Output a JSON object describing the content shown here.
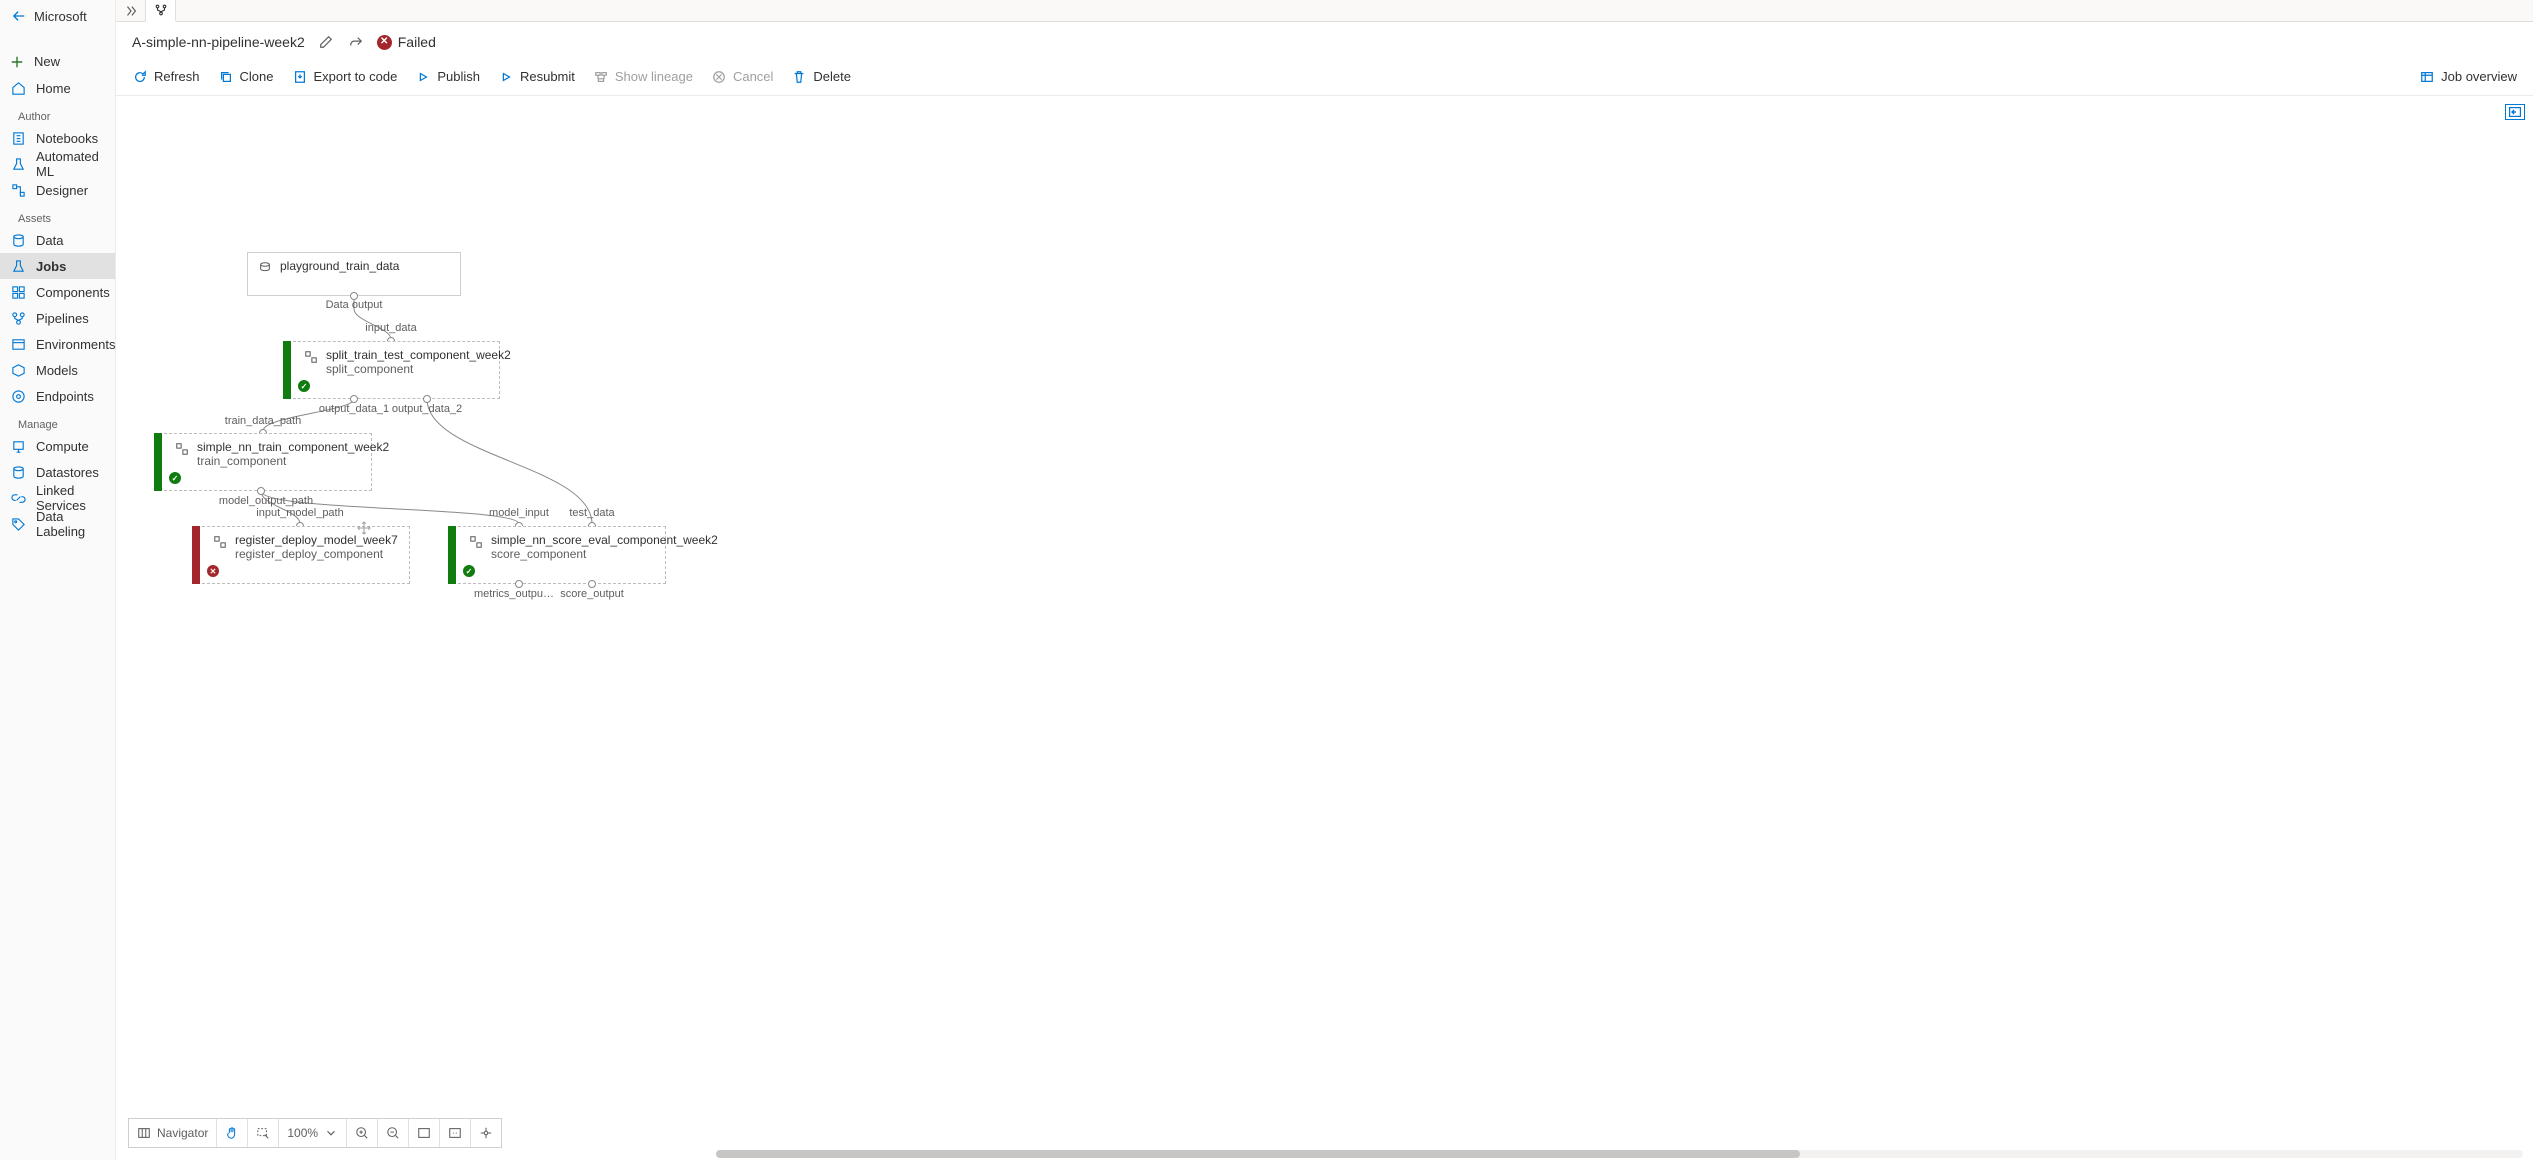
{
  "sidebar": {
    "brand": "Microsoft",
    "new": "New",
    "home": "Home",
    "sections": {
      "author": "Author",
      "assets": "Assets",
      "manage": "Manage"
    },
    "author": {
      "notebooks": "Notebooks",
      "automl": "Automated ML",
      "designer": "Designer"
    },
    "assets": {
      "data": "Data",
      "jobs": "Jobs",
      "components": "Components",
      "pipelines": "Pipelines",
      "environments": "Environments",
      "models": "Models",
      "endpoints": "Endpoints"
    },
    "manage": {
      "compute": "Compute",
      "datastores": "Datastores",
      "linked": "Linked Services",
      "labeling": "Data Labeling"
    }
  },
  "header": {
    "pipeline_name": "A-simple-nn-pipeline-week2",
    "status": "Failed"
  },
  "toolbar": {
    "refresh": "Refresh",
    "clone": "Clone",
    "export": "Export to code",
    "publish": "Publish",
    "resubmit": "Resubmit",
    "lineage": "Show lineage",
    "cancel": "Cancel",
    "delete": "Delete",
    "job_overview": "Job overview"
  },
  "graph": {
    "n_dataset": {
      "title": "playground_train_data"
    },
    "n_split": {
      "title": "split_train_test_component_week2",
      "subtitle": "split_component"
    },
    "n_train": {
      "title": "simple_nn_train_component_week2",
      "subtitle": "train_component"
    },
    "n_reg": {
      "title": "register_deploy_model_week7",
      "subtitle": "register_deploy_component"
    },
    "n_score": {
      "title": "simple_nn_score_eval_component_week2",
      "subtitle": "score_component"
    },
    "ports": {
      "data_output": "Data output",
      "input_data": "input_data",
      "output_data_1": "output_data_1",
      "output_data_2": "output_data_2",
      "train_data_path": "train_data_path",
      "model_output_path": "model_output_path",
      "input_model_path": "input_model_path",
      "model_input": "model_input",
      "test_data": "test_data",
      "metrics_output": "metrics_outpu…",
      "score_output": "score_output"
    }
  },
  "navigator": {
    "label": "Navigator",
    "zoom": "100%"
  }
}
